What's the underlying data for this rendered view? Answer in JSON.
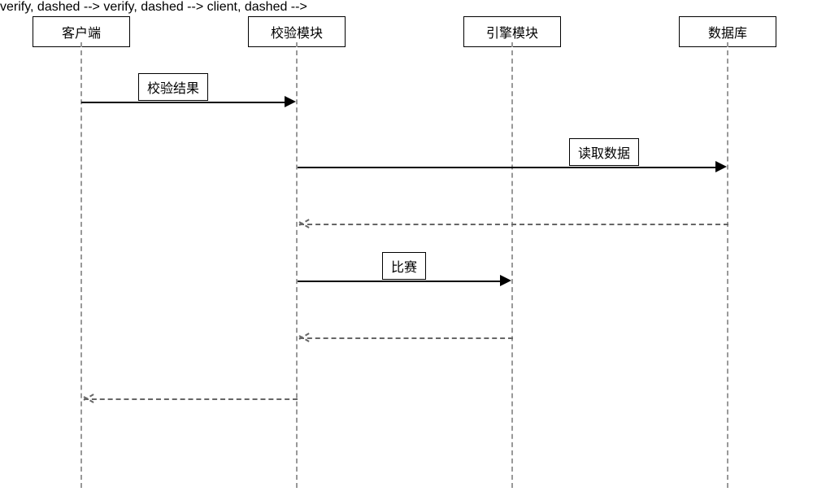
{
  "participants": {
    "client": {
      "label": "客户端"
    },
    "verify": {
      "label": "校验模块"
    },
    "engine": {
      "label": "引擎模块"
    },
    "database": {
      "label": "数据库"
    }
  },
  "messages": {
    "m1": {
      "label": "校验结果"
    },
    "m2": {
      "label": "读取数据"
    },
    "m3": {
      "label": "比赛"
    }
  }
}
